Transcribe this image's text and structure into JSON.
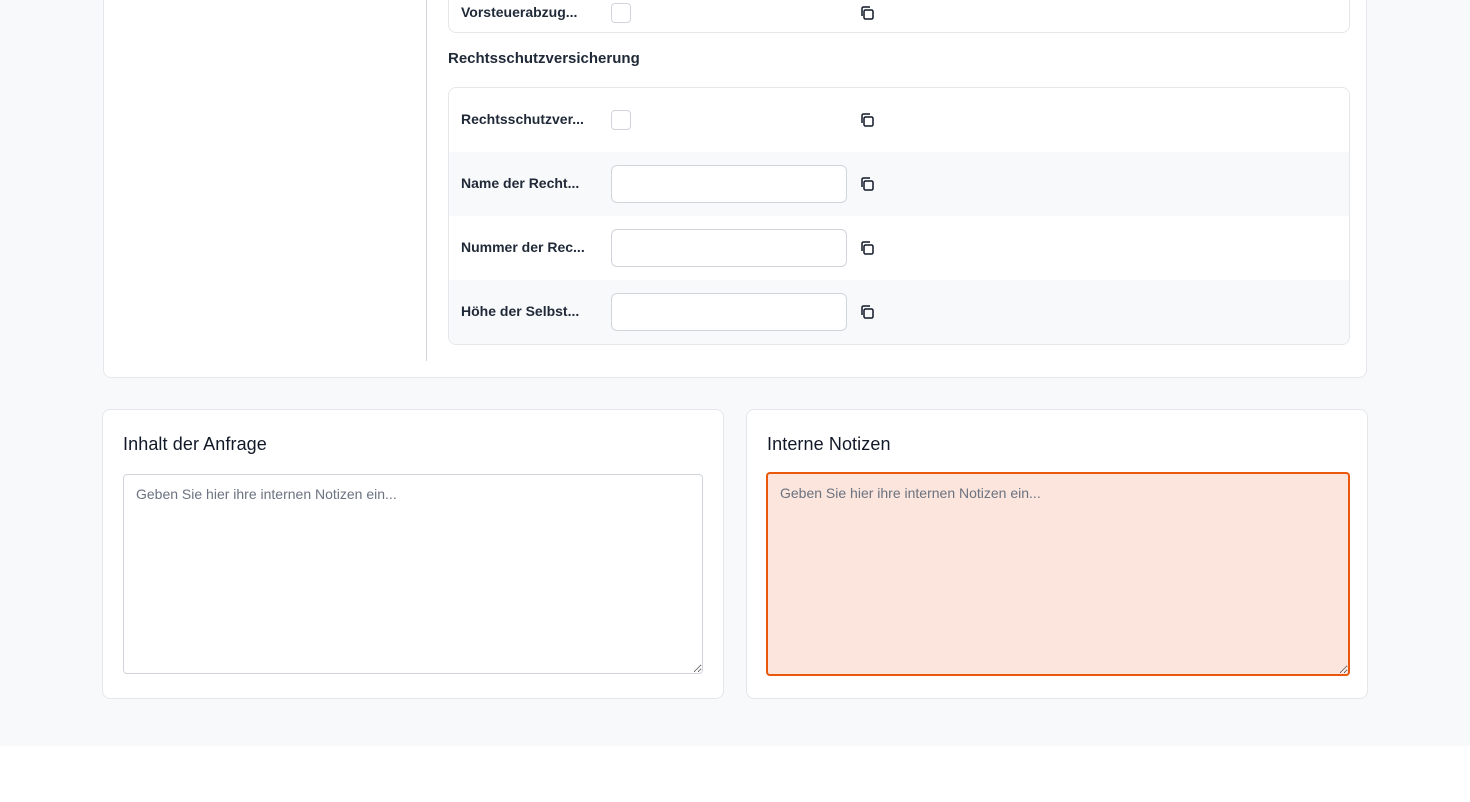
{
  "colors": {
    "page_background": "#f8f9fb",
    "focus_accent": "#ea580c",
    "focus_fill": "#fbe5dc",
    "border": "#e5e7eb"
  },
  "top_section": {
    "previous_row": {
      "label": "Vorsteuerabzug...",
      "type": "checkbox",
      "checked": false
    },
    "rechtsschutz": {
      "title": "Rechtsschutzversicherung",
      "rows": [
        {
          "label": "Rechtsschutzver...",
          "type": "checkbox",
          "checked": false,
          "copy_icon": "copy-icon"
        },
        {
          "label": "Name der Recht...",
          "type": "text",
          "value": "",
          "copy_icon": "copy-icon"
        },
        {
          "label": "Nummer der Rec...",
          "type": "text",
          "value": "",
          "copy_icon": "copy-icon"
        },
        {
          "label": "Höhe der Selbst...",
          "type": "text",
          "value": "",
          "copy_icon": "copy-icon"
        }
      ]
    }
  },
  "request_panel": {
    "title": "Inhalt der Anfrage",
    "placeholder": "Geben Sie hier ihre internen Notizen ein...",
    "value": ""
  },
  "notes_panel": {
    "title": "Interne Notizen",
    "placeholder": "Geben Sie hier ihre internen Notizen ein...",
    "value": "",
    "focused": true
  }
}
